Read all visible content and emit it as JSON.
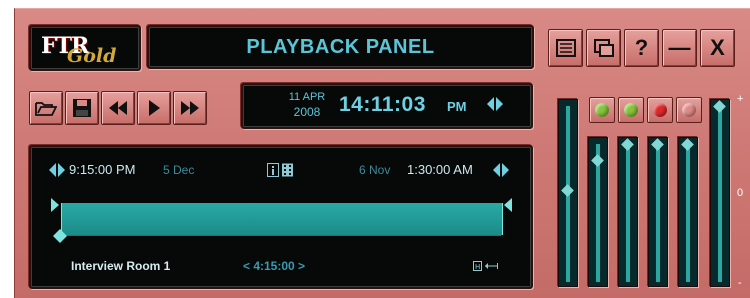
{
  "logo": {
    "ftr": "FTR",
    "gold": "Gold"
  },
  "title": "PLAYBACK PANEL",
  "window_buttons": [
    {
      "name": "menu",
      "label": ""
    },
    {
      "name": "restore",
      "label": ""
    },
    {
      "name": "help",
      "label": "?"
    },
    {
      "name": "minimize",
      "label": "—"
    },
    {
      "name": "close",
      "label": "X"
    }
  ],
  "transport": [
    "open",
    "save",
    "rewind",
    "play",
    "fast-forward"
  ],
  "datetime": {
    "day": "11 APR",
    "year": "2008",
    "time": "14:11:03",
    "ampm": "PM"
  },
  "timeline": {
    "start_time": "9:15:00 PM",
    "start_date": "5 Dec",
    "end_date": "6 Nov",
    "end_time": "1:30:00 AM",
    "room": "Interview Room 1",
    "duration": "< 4:15:00 >"
  },
  "lamps": [
    {
      "name": "green-1",
      "color": "#86c43a"
    },
    {
      "name": "green-2",
      "color": "#86c43a"
    },
    {
      "name": "red",
      "color": "#e0282c"
    },
    {
      "name": "off",
      "color": "#e08a86"
    }
  ],
  "channel_levels": [
    0.5,
    0.95,
    0.95,
    0.95,
    0.95,
    1.0
  ],
  "scale": {
    "plus": "+",
    "zero": "0",
    "minus": "-"
  },
  "colors": {
    "lcd_text": "#5cc4d7",
    "track": "#2aa9a4",
    "body": "#cf7a76"
  }
}
